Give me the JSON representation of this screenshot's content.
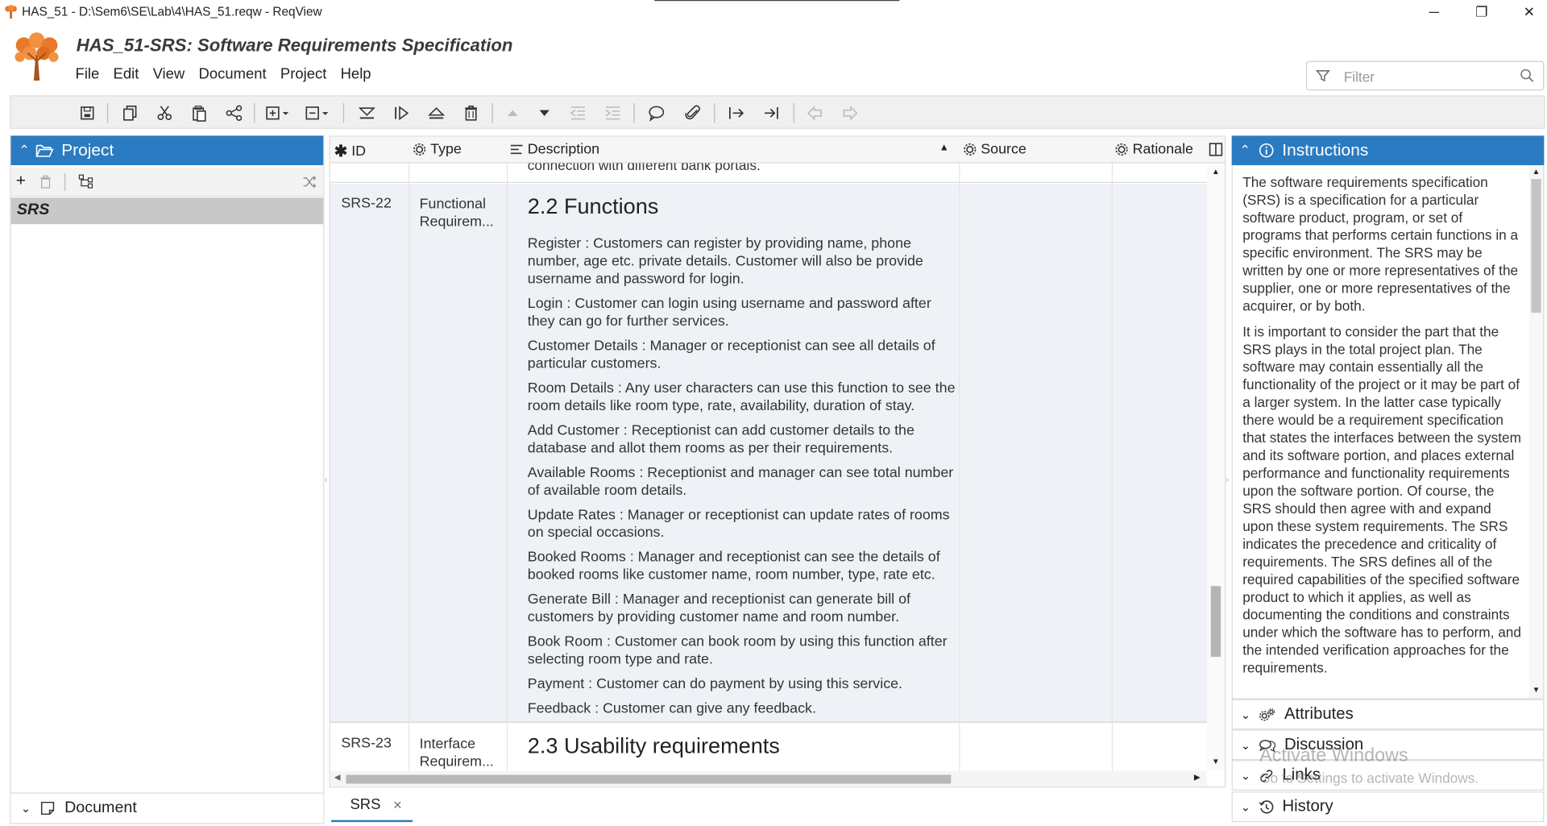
{
  "window": {
    "title": "HAS_51 - D:\\Sem6\\SE\\Lab\\4\\HAS_51.reqw - ReqView",
    "minimize": "─",
    "maximize": "❐",
    "close": "✕"
  },
  "header": {
    "doc_title": "HAS_51-SRS: Software Requirements Specification",
    "filter_placeholder": "Filter"
  },
  "menu": [
    "File",
    "Edit",
    "View",
    "Document",
    "Project",
    "Help"
  ],
  "left_panel": {
    "title": "Project",
    "tree_item": "SRS",
    "footer": "Document"
  },
  "grid": {
    "columns": {
      "id": "ID",
      "type": "Type",
      "description": "Description",
      "source": "Source",
      "rationale": "Rationale"
    },
    "cut_row_text": "connection with different bank portals.",
    "rows": [
      {
        "id": "SRS-22",
        "type": "Functional Requirem...",
        "heading": "2.2 Functions",
        "paragraphs": [
          "Register : Customers can register by providing name, phone number, age etc. private details. Customer will also be provide username and password for login.",
          "Login : Customer can login using username and password after they can go for further services.",
          "Customer Details : Manager or receptionist can see all details of particular customers.",
          "Room Details : Any user characters can use this function to see the room details like room type, rate, availability, duration of stay.",
          "Add Customer : Receptionist can add customer details to the database and allot them rooms as per their requirements.",
          "Available Rooms : Receptionist and manager can see total number of available room details.",
          "Update Rates : Manager or receptionist can update rates of rooms on special occasions.",
          "Booked Rooms : Manager and receptionist can see the details of booked rooms like customer name, room number, type, rate etc.",
          "Generate Bill : Manager and receptionist can generate bill of customers by providing customer name and room number.",
          "Book Room : Customer can book room by using this function after selecting room type and rate.",
          "Payment : Customer can do payment by using this service.",
          "Feedback : Customer can give any feedback."
        ]
      },
      {
        "id": "SRS-23",
        "type": "Interface Requirem...",
        "heading": "2.3 Usability requirements"
      }
    ],
    "tab": "SRS"
  },
  "right_panel": {
    "title": "Instructions",
    "paragraphs": [
      "The software requirements specification (SRS) is a specification for a particular software product, program, or set of programs that performs certain functions in a specific environment. The SRS may be written by one or more representatives of the supplier, one or more representatives of the acquirer, or by both.",
      "It is important to consider the part that the SRS plays in the total project plan. The software may contain essentially all the functionality of the project or it may be part of a larger system. In the latter case typically there would be a requirement specification that states the interfaces between the system and its software portion, and places external performance and functionality requirements upon the software portion. Of course, the SRS should then agree with and expand upon these system requirements. The SRS indicates the precedence and criticality of requirements. The SRS defines all of the required capabilities of the specified software product to which it applies, as well as documenting the conditions and constraints under which the software has to perform, and the intended verification approaches for the requirements."
    ],
    "sections": [
      "Attributes",
      "Discussion",
      "Links",
      "History"
    ]
  },
  "watermark": {
    "line1": "Activate Windows",
    "line2": "Go to Settings to activate Windows."
  },
  "colors": {
    "accent": "#2b7bc2",
    "selected_row": "#eef1f6",
    "tree_selected": "#c8c8c8"
  }
}
